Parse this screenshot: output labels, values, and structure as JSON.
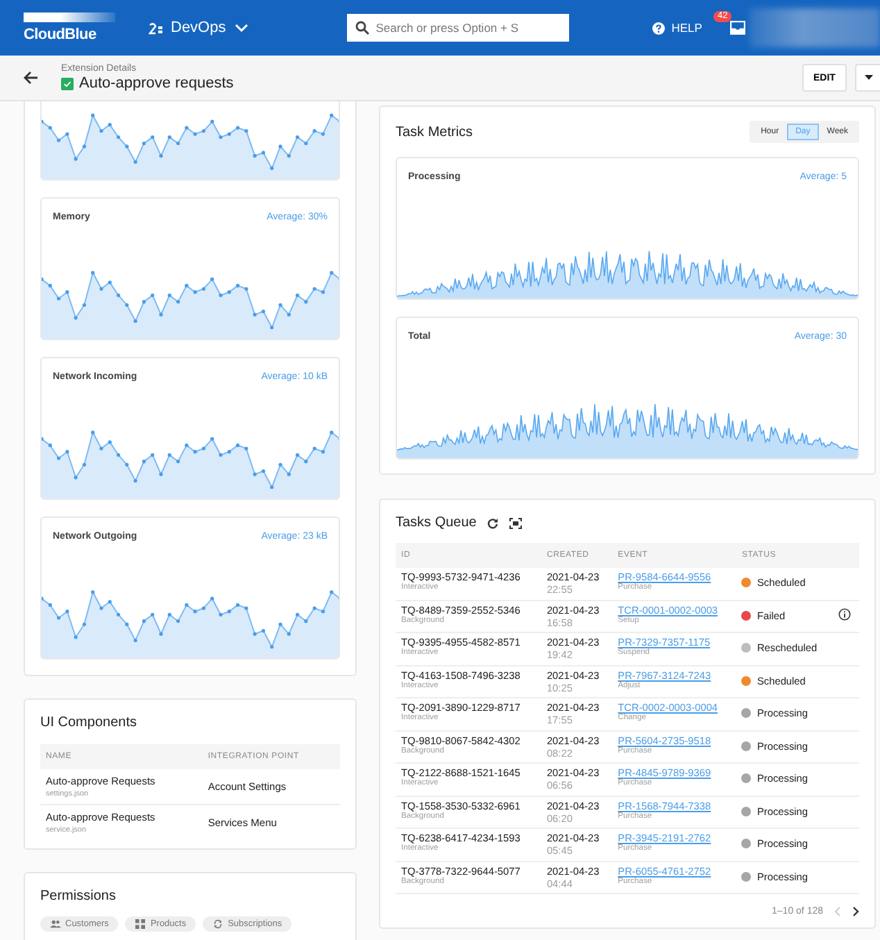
{
  "header": {
    "brand": "CloudBlue",
    "workspace": "DevOps",
    "search": {
      "placeholder": "Search or press Option + S"
    },
    "help": "HELP",
    "inbox_badge": "42"
  },
  "subheader": {
    "breadcrumb": "Extension Details",
    "title": "Auto-approve requests",
    "edit": "EDIT"
  },
  "resource_charts": [
    {
      "kind": "cut"
    },
    {
      "kind": "full",
      "title": "Memory",
      "average": "Average: 30%"
    },
    {
      "kind": "full",
      "title": "Network Incoming",
      "average": "Average: 10 kB"
    },
    {
      "kind": "full",
      "title": "Network Outgoing",
      "average": "Average: 23 kB"
    }
  ],
  "ui_components": {
    "title": "UI Components",
    "columns": [
      "NAME",
      "INTEGRATION POINT"
    ],
    "rows": [
      {
        "name": "Auto-approve Requests",
        "file": "settings.json",
        "integration_point": "Account Settings"
      },
      {
        "name": "Auto-approve Requests",
        "file": "service.json",
        "integration_point": "Services Menu"
      }
    ]
  },
  "permissions": {
    "title": "Permissions",
    "chips": [
      {
        "kind": "people",
        "label": "Customers"
      },
      {
        "kind": "grid",
        "label": "Products"
      },
      {
        "kind": "sync",
        "label": "Subscriptions"
      }
    ]
  },
  "task_metrics": {
    "title": "Task Metrics",
    "ranges": [
      {
        "label": "Hour",
        "selected": false
      },
      {
        "label": "Day",
        "selected": true
      },
      {
        "label": "Week",
        "selected": false
      }
    ],
    "charts": [
      {
        "title": "Processing",
        "average": "Average: 5"
      },
      {
        "title": "Total",
        "average": "Average: 30"
      }
    ]
  },
  "tasks_queue": {
    "title": "Tasks Queue",
    "columns": [
      "ID",
      "CREATED",
      "EVENT",
      "STATUS"
    ],
    "rows": [
      {
        "id": "TQ-9993-5732-9471-4236",
        "type": "Interactive",
        "date": "2021-04-23",
        "time": "22:55",
        "event": "PR-9584-6644-9556",
        "event_type": "Purchase",
        "status": "Scheduled",
        "color": "#f0892c",
        "info": false
      },
      {
        "id": "TQ-8489-7359-2552-5346",
        "type": "Background",
        "date": "2021-04-23",
        "time": "16:58",
        "event": "TCR-0001-0002-0003",
        "event_type": "Setup",
        "status": "Failed",
        "color": "#e5484d",
        "info": true
      },
      {
        "id": "TQ-9395-4955-4582-8571",
        "type": "Interactive",
        "date": "2021-04-23",
        "time": "19:42",
        "event": "PR-7329-7357-1175",
        "event_type": "Suspend",
        "status": "Rescheduled",
        "color": "#bdbdbd",
        "info": false
      },
      {
        "id": "TQ-4163-1508-7496-3238",
        "type": "Interactive",
        "date": "2021-04-23",
        "time": "10:25",
        "event": "PR-7967-3124-7243",
        "event_type": "Adjust",
        "status": "Scheduled",
        "color": "#f0892c",
        "info": false
      },
      {
        "id": "TQ-2091-3890-1229-8717",
        "type": "Interactive",
        "date": "2021-04-23",
        "time": "17:55",
        "event": "TCR-0002-0003-0004",
        "event_type": "Change",
        "status": "Processing",
        "color": "#a6a6a6",
        "info": false
      },
      {
        "id": "TQ-9810-8067-5842-4302",
        "type": "Background",
        "date": "2021-04-23",
        "time": "08:22",
        "event": "PR-5604-2735-9518",
        "event_type": "Purchase",
        "status": "Processing",
        "color": "#a6a6a6",
        "info": false
      },
      {
        "id": "TQ-2122-8688-1521-1645",
        "type": "Interactive",
        "date": "2021-04-23",
        "time": "06:56",
        "event": "PR-4845-9789-9369",
        "event_type": "Purchase",
        "status": "Processing",
        "color": "#a6a6a6",
        "info": false
      },
      {
        "id": "TQ-1558-3530-5332-6961",
        "type": "Background",
        "date": "2021-04-23",
        "time": "06:20",
        "event": "PR-1568-7944-7338",
        "event_type": "Purchase",
        "status": "Processing",
        "color": "#a6a6a6",
        "info": false
      },
      {
        "id": "TQ-6238-6417-4234-1593",
        "type": "Interactive",
        "date": "2021-04-23",
        "time": "05:45",
        "event": "PR-3945-2191-2762",
        "event_type": "Purchase",
        "status": "Processing",
        "color": "#a6a6a6",
        "info": false
      },
      {
        "id": "TQ-3778-7322-9644-5077",
        "type": "Background",
        "date": "2021-04-23",
        "time": "04:44",
        "event": "PR-6055-4761-2752",
        "event_type": "Purchase",
        "status": "Processing",
        "color": "#a6a6a6",
        "info": false
      }
    ],
    "pagination": "1–10 of 128"
  }
}
